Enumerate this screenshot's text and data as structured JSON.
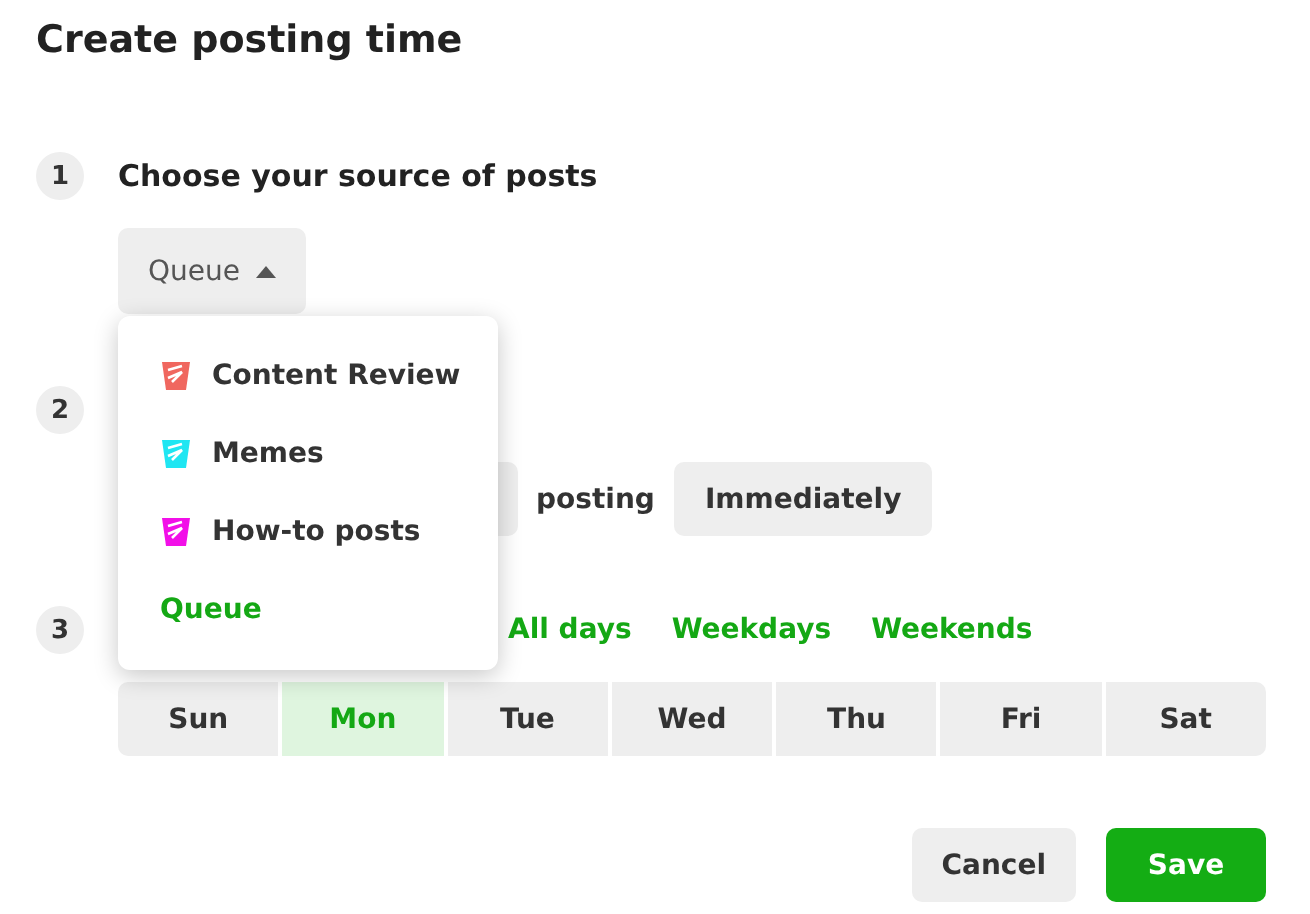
{
  "title": "Create posting time",
  "steps": [
    {
      "number": "1",
      "label": "Choose your source of posts"
    },
    {
      "number": "2"
    },
    {
      "number": "3"
    }
  ],
  "source_select": {
    "value": "Queue",
    "expanded": true
  },
  "source_menu": [
    {
      "label": "Content Review",
      "color": "#f0675f",
      "selected": false
    },
    {
      "label": "Memes",
      "color": "#1fe6f2",
      "selected": false
    },
    {
      "label": "How-to posts",
      "color": "#f20fe8",
      "selected": false
    },
    {
      "label": "Queue",
      "selected": true
    }
  ],
  "posting": {
    "text": "posting",
    "mode": "Immediately"
  },
  "day_shortcuts": [
    "All days",
    "Weekdays",
    "Weekends"
  ],
  "days": [
    {
      "label": "Sun",
      "selected": false
    },
    {
      "label": "Mon",
      "selected": true
    },
    {
      "label": "Tue",
      "selected": false
    },
    {
      "label": "Wed",
      "selected": false
    },
    {
      "label": "Thu",
      "selected": false
    },
    {
      "label": "Fri",
      "selected": false
    },
    {
      "label": "Sat",
      "selected": false
    }
  ],
  "buttons": {
    "cancel": "Cancel",
    "save": "Save"
  }
}
